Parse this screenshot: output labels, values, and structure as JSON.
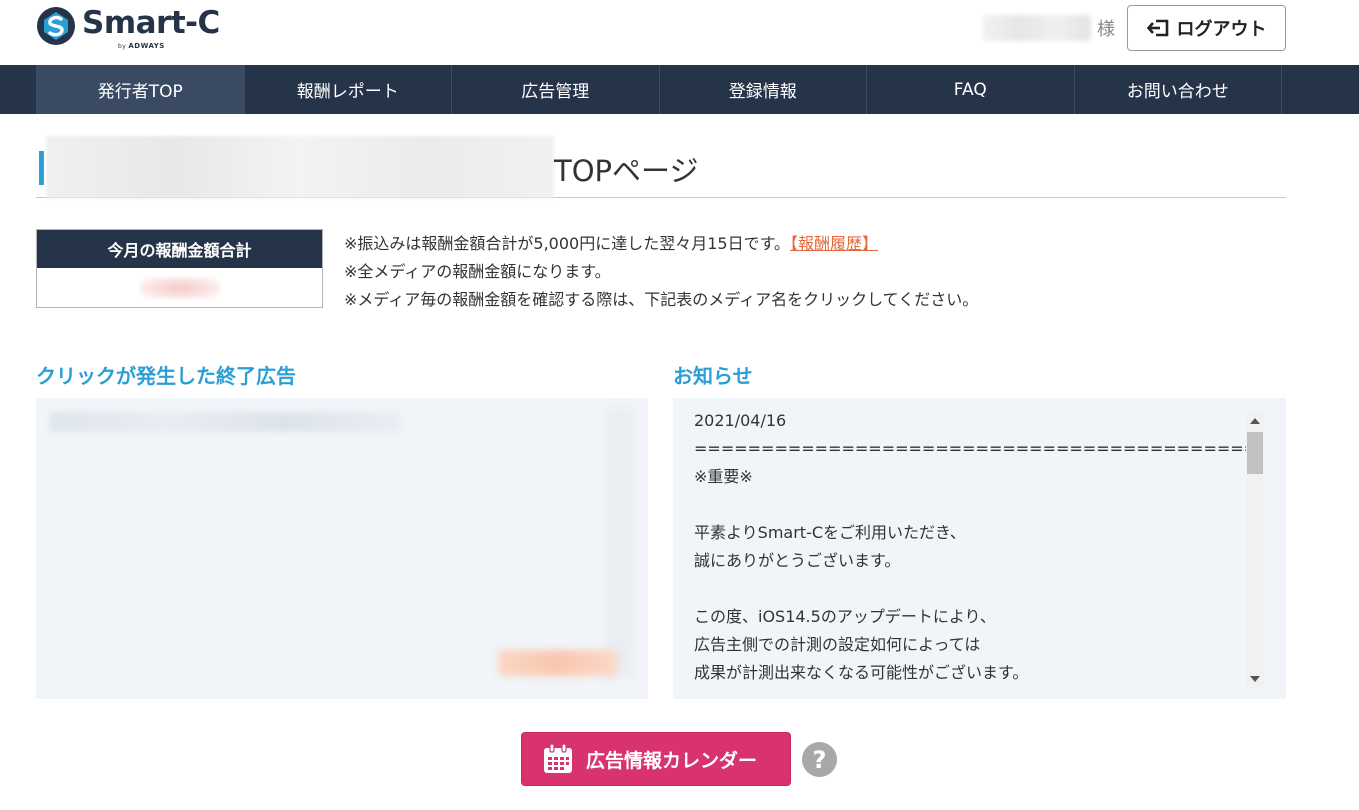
{
  "header": {
    "brand": "Smart-C",
    "brand_sub_by": "by",
    "brand_sub": "ADWAYS",
    "user_suffix": "様",
    "logout_label": "ログアウト"
  },
  "nav": {
    "items": [
      {
        "label": "発行者TOP",
        "active": true
      },
      {
        "label": "報酬レポート",
        "active": false
      },
      {
        "label": "広告管理",
        "active": false
      },
      {
        "label": "登録情報",
        "active": false
      },
      {
        "label": "FAQ",
        "active": false
      },
      {
        "label": "お問い合わせ",
        "active": false
      }
    ]
  },
  "page": {
    "title_suffix": "TOPページ"
  },
  "reward": {
    "heading": "今月の報酬金額合計"
  },
  "notes": {
    "line1": "※振込みは報酬金額合計が5,000円に達した翌々月15日です。",
    "line1_link": "【報酬履歴】",
    "line2": "※全メディアの報酬金額になります。",
    "line3": "※メディア毎の報酬金額を確認する際は、下記表のメディア名をクリックしてください。"
  },
  "ended_ads": {
    "title": "クリックが発生した終了広告"
  },
  "notice": {
    "title": "お知らせ",
    "lines": [
      "2021/04/16",
      "==========================================",
      "※重要※",
      "",
      "平素よりSmart-Cをご利用いただき、",
      "誠にありがとうございます。",
      "",
      "この度、iOS14.5のアップデートにより、",
      "広告主側での計測の設定如何によっては",
      "成果が計測出来なくなる可能性がございます。"
    ]
  },
  "calendar": {
    "label": "広告情報カレンダー",
    "help": "?"
  },
  "colors": {
    "navy": "#26344a",
    "accent_blue": "#2a9fd6",
    "link_orange": "#e4683a",
    "calendar_pink": "#d8336f"
  }
}
